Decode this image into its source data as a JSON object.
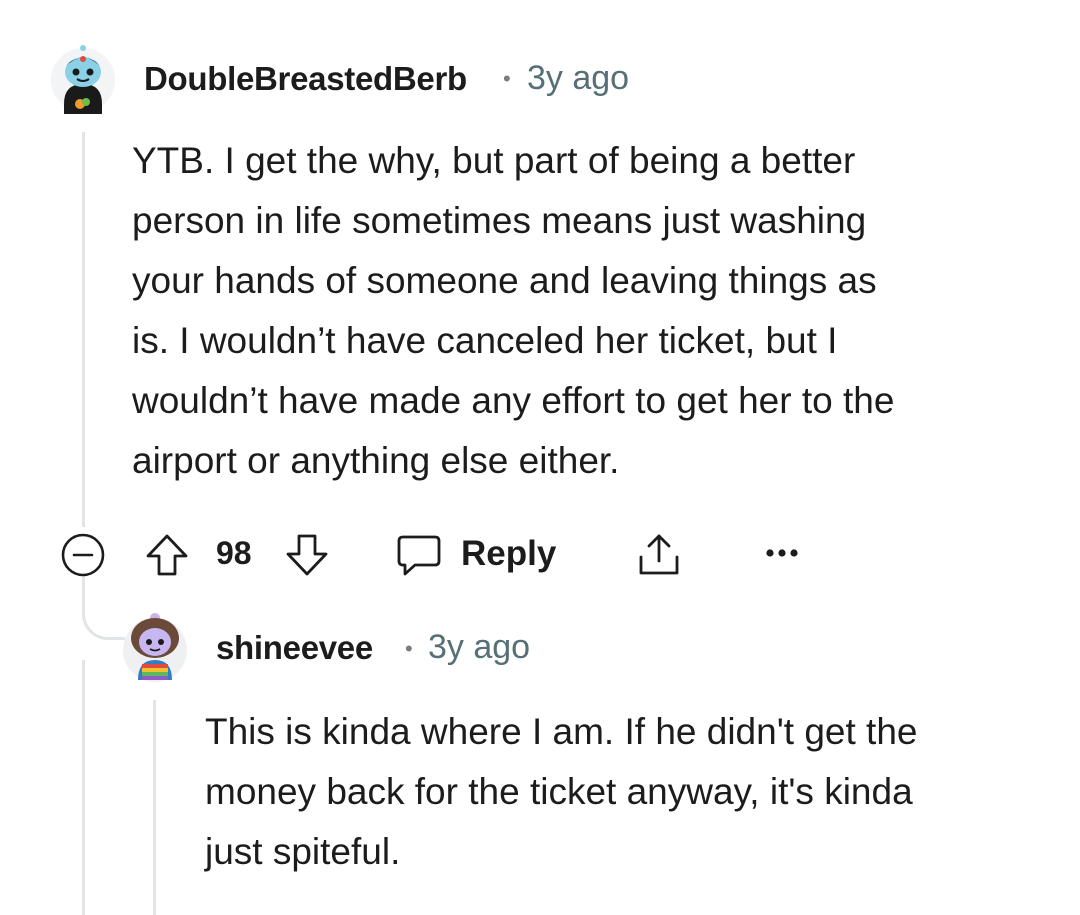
{
  "comments": [
    {
      "username": "DoubleBreastedBerb",
      "separator": "•",
      "timestamp": "3y ago",
      "body_lines": [
        "YTB. I get the why, but part of being a better",
        "person in life sometimes means just washing",
        "your hands of someone and leaving things as",
        "is. I wouldn’t have canceled her ticket, but I",
        "wouldn’t have made any effort to get her to the",
        "airport or anything else either."
      ],
      "avatar_icon": "snoo-avatar",
      "actions": {
        "collapse_icon": "collapse-minus-icon",
        "upvote_icon": "upvote-arrow-icon",
        "score": "98",
        "downvote_icon": "downvote-arrow-icon",
        "reply_icon": "speech-bubble-icon",
        "reply_label": "Reply",
        "share_icon": "share-icon",
        "more_icon": "more-dots-icon"
      }
    },
    {
      "username": "shineevee",
      "separator": "•",
      "timestamp": "3y ago",
      "body_lines": [
        "This is kinda where I am. If he didn't get the",
        "money back for the ticket anyway, it's kinda",
        "just spiteful."
      ],
      "avatar_icon": "snoo-avatar"
    }
  ],
  "colors": {
    "thread_line": "#e2e5e8",
    "text": "#1c1c1c",
    "meta": "#576f76"
  }
}
